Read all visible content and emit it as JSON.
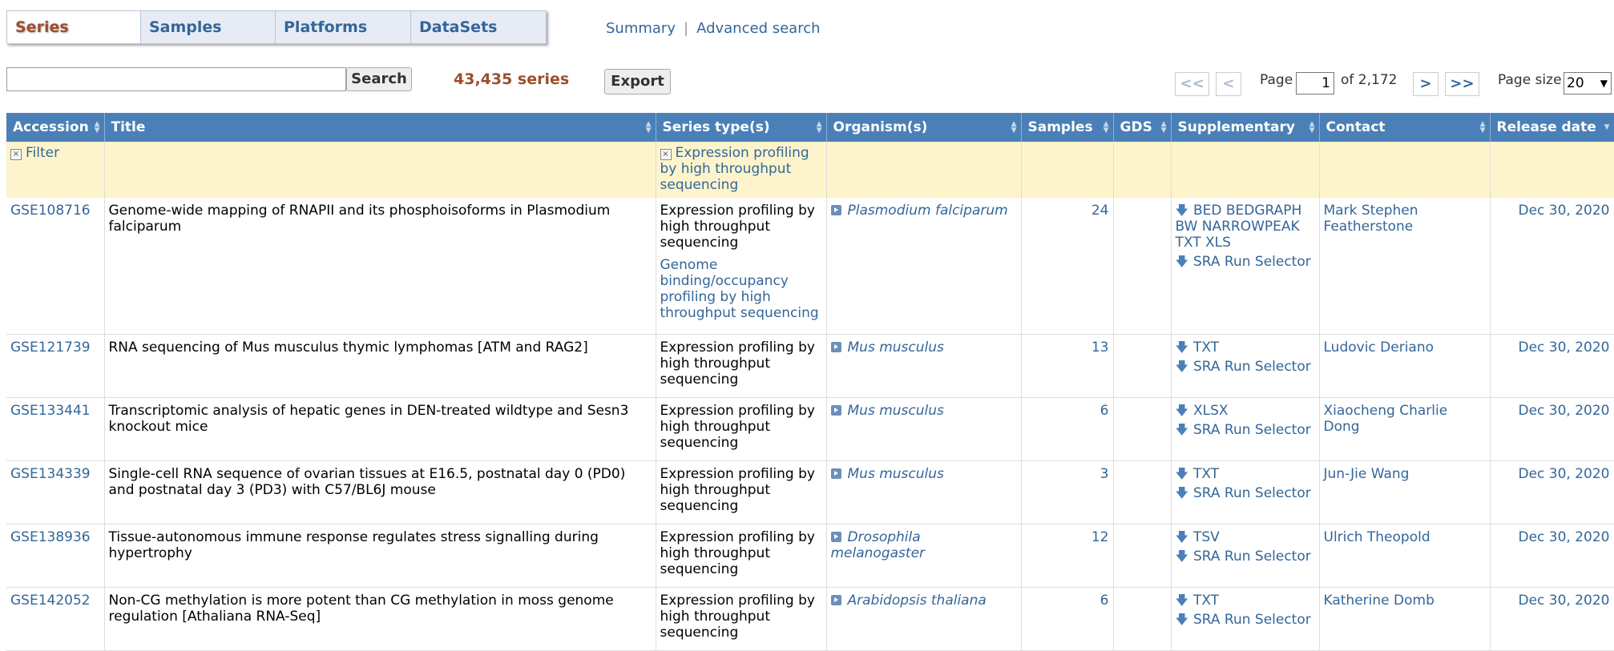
{
  "tabs": [
    {
      "label": "Series"
    },
    {
      "label": "Samples"
    },
    {
      "label": "Platforms"
    },
    {
      "label": "DataSets"
    }
  ],
  "top_links": {
    "summary": "Summary",
    "advanced": "Advanced search"
  },
  "search": {
    "button": "Search",
    "count": "43,435 series",
    "export": "Export"
  },
  "pager": {
    "first": "<<",
    "prev": "<",
    "page_label": "Page",
    "page_value": "1",
    "of_label": "of 2,172",
    "next": ">",
    "last": ">>",
    "size_label": "Page size",
    "size_value": "20"
  },
  "columns": [
    "Accession",
    "Title",
    "Series type(s)",
    "Organism(s)",
    "Samples",
    "GDS",
    "Supplementary",
    "Contact",
    "Release date"
  ],
  "filter": {
    "label": "Filter",
    "series_type": "Expression profiling by high throughput sequencing"
  },
  "rows": [
    {
      "accession": "GSE108716",
      "title": "Genome-wide mapping of RNAPII and its phosphoisoforms in Plasmodium falciparum",
      "type": "Expression profiling by high throughput sequencing",
      "type2": "Genome binding/occupancy profiling by high throughput sequencing",
      "organism": "Plasmodium falciparum",
      "samples": "24",
      "supp": "BED BEDGRAPH BW NARROWPEAK TXT XLS",
      "sra": "SRA Run Selector",
      "contact": "Mark Stephen Featherstone",
      "date": "Dec 30, 2020"
    },
    {
      "accession": "GSE121739",
      "title": "RNA sequencing of Mus musculus thymic lymphomas [ATM and RAG2]",
      "type": "Expression profiling by high throughput sequencing",
      "organism": "Mus musculus",
      "samples": "13",
      "supp": "TXT",
      "sra": "SRA Run Selector",
      "contact": "Ludovic Deriano",
      "date": "Dec 30, 2020"
    },
    {
      "accession": "GSE133441",
      "title": "Transcriptomic analysis of hepatic genes in DEN-treated wildtype and Sesn3 knockout mice",
      "type": "Expression profiling by high throughput sequencing",
      "organism": "Mus musculus",
      "samples": "6",
      "supp": "XLSX",
      "sra": "SRA Run Selector",
      "contact": "Xiaocheng Charlie Dong",
      "date": "Dec 30, 2020"
    },
    {
      "accession": "GSE134339",
      "title": "Single-cell RNA sequence of ovarian tissues at E16.5, postnatal day 0 (PD0) and postnatal day 3 (PD3) with C57/BL6J mouse",
      "type": "Expression profiling by high throughput sequencing",
      "organism": "Mus musculus",
      "samples": "3",
      "supp": "TXT",
      "sra": "SRA Run Selector",
      "contact": "Jun-Jie Wang",
      "date": "Dec 30, 2020"
    },
    {
      "accession": "GSE138936",
      "title": "Tissue-autonomous immune response regulates stress signalling during hypertrophy",
      "type": "Expression profiling by high throughput sequencing",
      "organism": "Drosophila melanogaster",
      "samples": "12",
      "supp": "TSV",
      "sra": "SRA Run Selector",
      "contact": "Ulrich Theopold",
      "date": "Dec 30, 2020"
    },
    {
      "accession": "GSE142052",
      "title": "Non-CG methylation is more potent than CG methylation in moss genome regulation [Athaliana RNA-Seq]",
      "type": "Expression profiling by high throughput sequencing",
      "organism": "Arabidopsis thaliana",
      "samples": "6",
      "supp": "TXT",
      "sra": "SRA Run Selector",
      "contact": "Katherine Domb",
      "date": "Dec 30, 2020"
    }
  ]
}
